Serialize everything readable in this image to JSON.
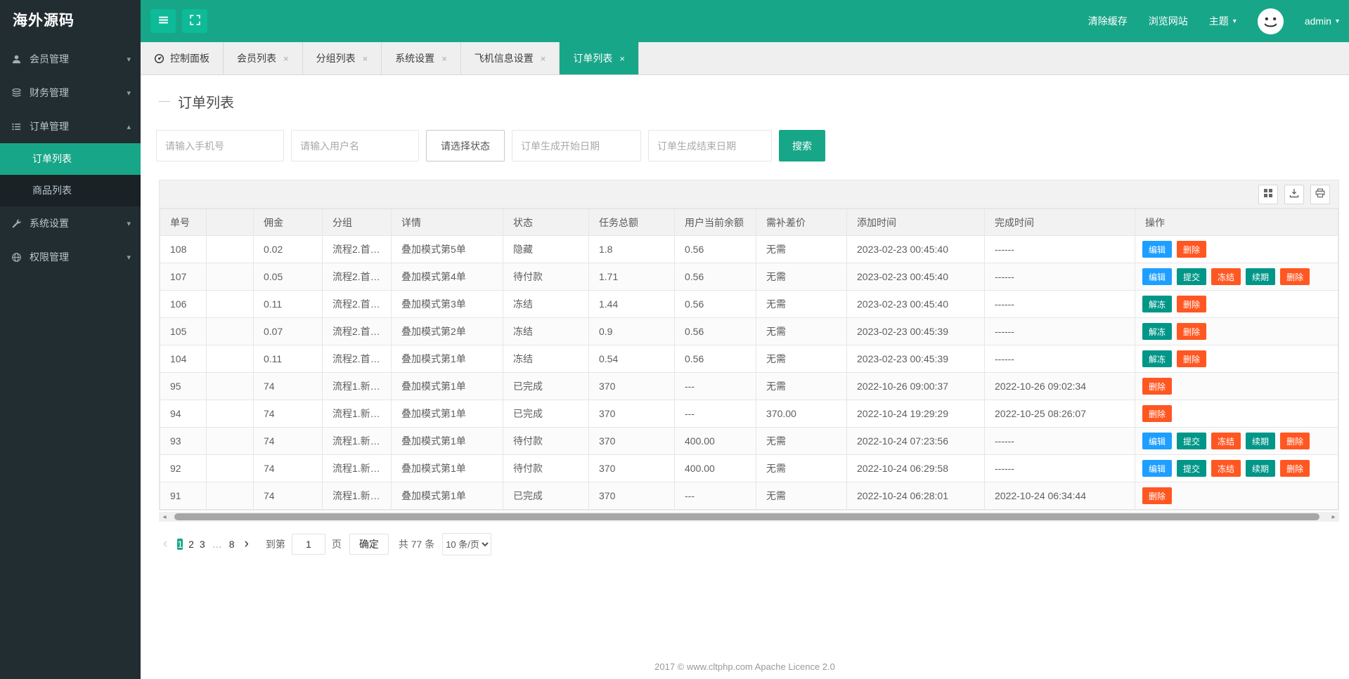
{
  "colors": {
    "accent": "#18a689",
    "sidebar_bg": "#222d32",
    "sidebar_sub_bg": "#1a2226",
    "button_blue": "#1e9fff",
    "button_teal": "#009688",
    "button_orange": "#ff5722"
  },
  "app": {
    "logo": "海外源码"
  },
  "topbar": {
    "clear_cache": "清除缓存",
    "browse_site": "浏览网站",
    "theme": "主题",
    "username": "admin"
  },
  "sidebar": {
    "items": [
      {
        "label": "会员管理",
        "icon": "user-icon",
        "caret": "down"
      },
      {
        "label": "财务管理",
        "icon": "finance-icon",
        "caret": "down"
      },
      {
        "label": "订单管理",
        "icon": "order-icon",
        "caret": "up",
        "children": [
          {
            "label": "订单列表",
            "active": true
          },
          {
            "label": "商品列表",
            "active": false
          }
        ]
      },
      {
        "label": "系统设置",
        "icon": "settings-icon",
        "caret": "down"
      },
      {
        "label": "权限管理",
        "icon": "globe-icon",
        "caret": "down"
      }
    ]
  },
  "tabs": [
    {
      "label": "控制面板",
      "icon": "dashboard-icon",
      "closable": false,
      "active": false
    },
    {
      "label": "会员列表",
      "closable": true,
      "active": false
    },
    {
      "label": "分组列表",
      "closable": true,
      "active": false
    },
    {
      "label": "系统设置",
      "closable": true,
      "active": false
    },
    {
      "label": "飞机信息设置",
      "closable": true,
      "active": false
    },
    {
      "label": "订单列表",
      "closable": true,
      "active": true
    }
  ],
  "page": {
    "title": "订单列表"
  },
  "filters": {
    "phone_placeholder": "请输入手机号",
    "username_placeholder": "请输入用户名",
    "status_placeholder": "请选择状态",
    "start_date_placeholder": "订单生成开始日期",
    "end_date_placeholder": "订单生成结束日期",
    "search_label": "搜索"
  },
  "table": {
    "columns": [
      "单号",
      "",
      "佣金",
      "分组",
      "详情",
      "状态",
      "任务总额",
      "用户当前余额",
      "需补差价",
      "添加时间",
      "完成时间",
      "操作"
    ],
    "action_defs": {
      "edit": {
        "label": "编辑",
        "style": "blue"
      },
      "submit": {
        "label": "提交",
        "style": "teal"
      },
      "freeze": {
        "label": "冻结",
        "style": "orange"
      },
      "renew": {
        "label": "续期",
        "style": "teal"
      },
      "delete": {
        "label": "删除",
        "style": "orange"
      },
      "unfreeze": {
        "label": "解冻",
        "style": "teal"
      }
    },
    "rows": [
      {
        "cells": [
          "108",
          "",
          "0.02",
          "流程2.首…",
          "叠加模式第5单",
          "隐藏",
          "1.8",
          "0.56",
          "无需",
          "2023-02-23 00:45:40",
          "------"
        ],
        "actions": [
          "edit",
          "delete"
        ]
      },
      {
        "cells": [
          "107",
          "",
          "0.05",
          "流程2.首…",
          "叠加模式第4单",
          "待付款",
          "1.71",
          "0.56",
          "无需",
          "2023-02-23 00:45:40",
          "------"
        ],
        "actions": [
          "edit",
          "submit",
          "freeze",
          "renew",
          "delete"
        ]
      },
      {
        "cells": [
          "106",
          "",
          "0.11",
          "流程2.首…",
          "叠加模式第3单",
          "冻结",
          "1.44",
          "0.56",
          "无需",
          "2023-02-23 00:45:40",
          "------"
        ],
        "actions": [
          "unfreeze",
          "delete"
        ]
      },
      {
        "cells": [
          "105",
          "",
          "0.07",
          "流程2.首…",
          "叠加模式第2单",
          "冻结",
          "0.9",
          "0.56",
          "无需",
          "2023-02-23 00:45:39",
          "------"
        ],
        "actions": [
          "unfreeze",
          "delete"
        ]
      },
      {
        "cells": [
          "104",
          "",
          "0.11",
          "流程2.首…",
          "叠加模式第1单",
          "冻结",
          "0.54",
          "0.56",
          "无需",
          "2023-02-23 00:45:39",
          "------"
        ],
        "actions": [
          "unfreeze",
          "delete"
        ]
      },
      {
        "cells": [
          "95",
          "",
          "74",
          "流程1.新…",
          "叠加模式第1单",
          "已完成",
          "370",
          "---",
          "无需",
          "2022-10-26 09:00:37",
          "2022-10-26 09:02:34"
        ],
        "actions": [
          "delete"
        ]
      },
      {
        "cells": [
          "94",
          "",
          "74",
          "流程1.新…",
          "叠加模式第1单",
          "已完成",
          "370",
          "---",
          "370.00",
          "2022-10-24 19:29:29",
          "2022-10-25 08:26:07"
        ],
        "actions": [
          "delete"
        ]
      },
      {
        "cells": [
          "93",
          "",
          "74",
          "流程1.新…",
          "叠加模式第1单",
          "待付款",
          "370",
          "400.00",
          "无需",
          "2022-10-24 07:23:56",
          "------"
        ],
        "actions": [
          "edit",
          "submit",
          "freeze",
          "renew",
          "delete"
        ]
      },
      {
        "cells": [
          "92",
          "",
          "74",
          "流程1.新…",
          "叠加模式第1单",
          "待付款",
          "370",
          "400.00",
          "无需",
          "2022-10-24 06:29:58",
          "------"
        ],
        "actions": [
          "edit",
          "submit",
          "freeze",
          "renew",
          "delete"
        ]
      },
      {
        "cells": [
          "91",
          "",
          "74",
          "流程1.新…",
          "叠加模式第1单",
          "已完成",
          "370",
          "---",
          "无需",
          "2022-10-24 06:28:01",
          "2022-10-24 06:34:44"
        ],
        "actions": [
          "delete"
        ]
      }
    ]
  },
  "pagination": {
    "prev": "‹",
    "next": "›",
    "pages": [
      "1",
      "2",
      "3",
      "…",
      "8"
    ],
    "active_page": "1",
    "jump_label": "到第",
    "jump_value": "1",
    "jump_unit": "页",
    "confirm_label": "确定",
    "total_label": "共 77 条",
    "per_page": "10 条/页"
  },
  "footer": {
    "text": "2017 ©  www.cltphp.com  Apache Licence 2.0"
  }
}
